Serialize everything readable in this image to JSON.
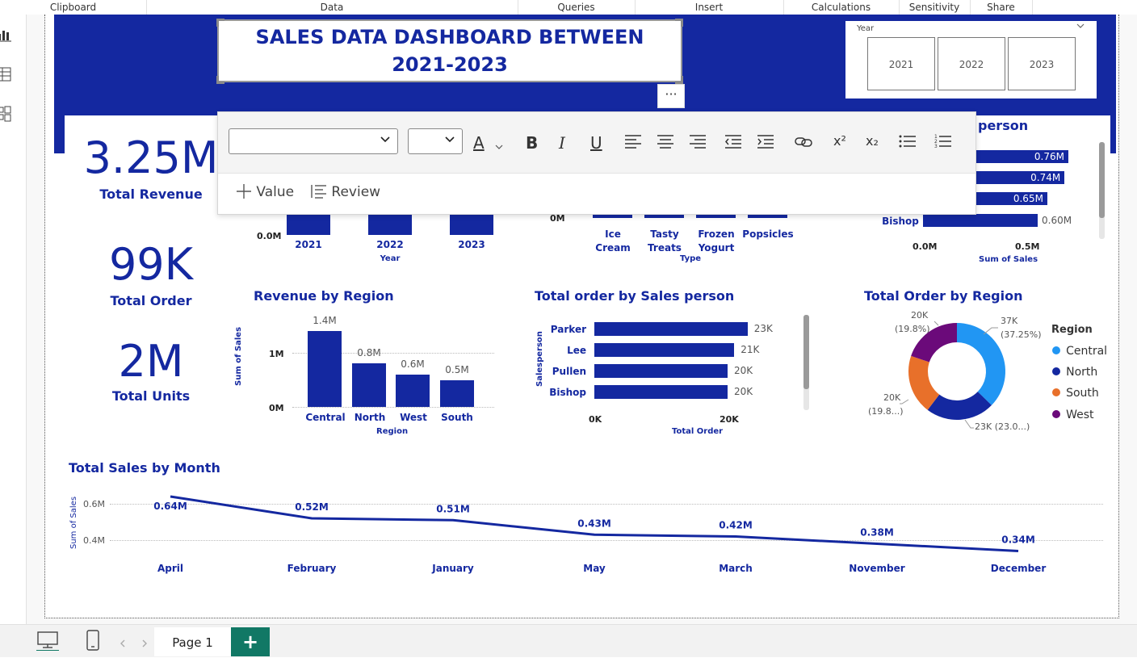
{
  "ribbon": {
    "groups": [
      "Clipboard",
      "Data",
      "Queries",
      "Insert",
      "Calculations",
      "Sensitivity",
      "Share"
    ]
  },
  "report": {
    "title_line1": "SALES DATA DASHBOARD BETWEEN",
    "title_line2": "2021-2023",
    "more_options": "···"
  },
  "year_slicer": {
    "label": "Year",
    "options": [
      "2021",
      "2022",
      "2023"
    ]
  },
  "kpis": {
    "revenue": {
      "value": "3.25M",
      "label": "Total Revenue"
    },
    "orders": {
      "value": "99K",
      "label": "Total Order"
    },
    "units": {
      "value": "2M",
      "label": "Total Units"
    }
  },
  "format_toolbar": {
    "font_value": "",
    "size_value": "",
    "font_color_label": "A",
    "bold_label": "B",
    "italic_label": "I",
    "underline_label": "U",
    "superscript_label": "x²",
    "subscript_label": "x₂",
    "value_action": "Value",
    "review_action": "Review"
  },
  "partial_titles": {
    "top_right_fragment": "person"
  },
  "bottom_bar": {
    "page_tab": "Page 1",
    "add_page": "+"
  },
  "colors": {
    "brand_blue": "#1428a0",
    "central": "#2196f3",
    "north": "#1428a0",
    "south": "#e8702a",
    "west": "#6b0a7a",
    "add_page_green": "#117865"
  },
  "chart_data": [
    {
      "id": "revenue_by_year",
      "type": "bar",
      "categories": [
        "2021",
        "2022",
        "2023"
      ],
      "xlabel": "Year",
      "ytick_visible": "0.0M",
      "partially_hidden": true
    },
    {
      "id": "sales_by_type",
      "type": "bar",
      "categories": [
        "Ice Cream",
        "Tasty Treats",
        "Frozen Yogurt",
        "Popsicles"
      ],
      "categories_lines": [
        [
          "Ice",
          "Cream"
        ],
        [
          "Tasty",
          "Treats"
        ],
        [
          "Frozen",
          "Yogurt"
        ],
        [
          "Popsicles"
        ]
      ],
      "xlabel": "Type",
      "ytick_visible": "0M",
      "partially_hidden": true
    },
    {
      "id": "sales_by_salesperson",
      "type": "bar",
      "orientation": "horizontal",
      "visible_categories": [
        "Bishop"
      ],
      "values": [
        0.76,
        0.74,
        0.65,
        0.6
      ],
      "data_labels": [
        "0.76M",
        "0.74M",
        "0.65M",
        "0.60M"
      ],
      "xlabel": "Sum of Sales",
      "xticks": [
        "0.0M",
        "0.5M"
      ],
      "xlim": [
        0,
        0.79
      ]
    },
    {
      "id": "revenue_by_region",
      "type": "bar",
      "title": "Revenue by Region",
      "categories": [
        "Central",
        "North",
        "West",
        "South"
      ],
      "values": [
        1.4,
        0.8,
        0.6,
        0.5
      ],
      "data_labels": [
        "1.4M",
        "0.8M",
        "0.6M",
        "0.5M"
      ],
      "xlabel": "Region",
      "ylabel": "Sum of Sales",
      "yticks": [
        "0M",
        "1M"
      ],
      "ylim": [
        0,
        1.5
      ]
    },
    {
      "id": "orders_by_salesperson",
      "type": "bar",
      "orientation": "horizontal",
      "title": "Total order by Sales person",
      "categories": [
        "Parker",
        "Lee",
        "Pullen",
        "Bishop"
      ],
      "values": [
        23,
        21,
        20,
        20
      ],
      "data_labels": [
        "23K",
        "21K",
        "20K",
        "20K"
      ],
      "xlabel": "Total Order",
      "ylabel": "Salesperson",
      "xticks": [
        "0K",
        "20K"
      ],
      "xlim": [
        0,
        24.4
      ]
    },
    {
      "id": "orders_by_region",
      "type": "pie",
      "donut": true,
      "title": "Total Order by Region",
      "legend_title": "Region",
      "legend_position": "right",
      "categories": [
        "Central",
        "North",
        "South",
        "West"
      ],
      "values": [
        37.25,
        23.0,
        19.8,
        19.8
      ],
      "data_labels": [
        [
          "37K",
          "(37.25%)"
        ],
        [
          "23K (23.0...)"
        ],
        [
          "20K",
          "(19.8...)"
        ],
        [
          "20K",
          "(19.8%)"
        ]
      ]
    },
    {
      "id": "sales_by_month",
      "type": "line",
      "title": "Total Sales by Month",
      "categories": [
        "April",
        "February",
        "January",
        "May",
        "March",
        "November",
        "December"
      ],
      "values": [
        0.64,
        0.52,
        0.51,
        0.43,
        0.42,
        0.38,
        0.34
      ],
      "data_labels": [
        "0.64M",
        "0.52M",
        "0.51M",
        "0.43M",
        "0.42M",
        "0.38M",
        "0.34M"
      ],
      "ylabel": "Sum of Sales",
      "yticks": [
        "0.6M",
        "0.4M"
      ],
      "ylim": [
        0.3,
        0.7
      ],
      "grid": true
    }
  ]
}
